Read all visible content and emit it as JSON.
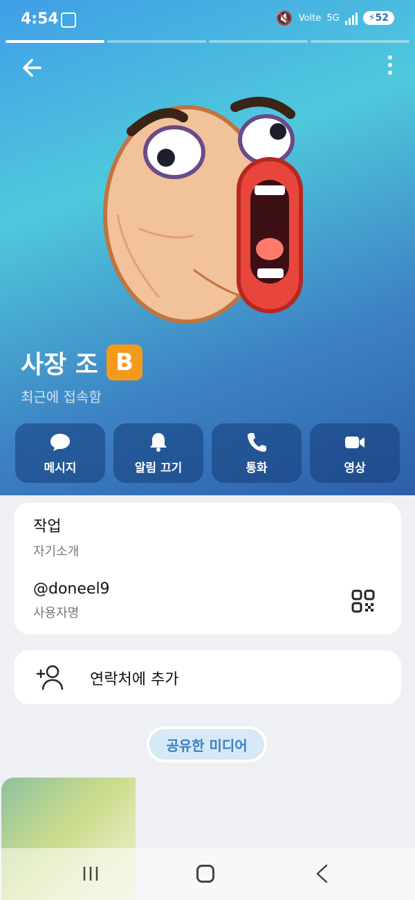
{
  "status_bar": {
    "time": "4:54",
    "network": "5G",
    "carrier_label": "Volte",
    "battery": "52"
  },
  "profile": {
    "name": "사장 조",
    "badge": "B",
    "status": "최근에 접속함"
  },
  "actions": [
    {
      "label": "메시지",
      "icon": "message-icon"
    },
    {
      "label": "알림 끄기",
      "icon": "bell-icon"
    },
    {
      "label": "통화",
      "icon": "phone-icon"
    },
    {
      "label": "영상",
      "icon": "video-icon"
    }
  ],
  "info": {
    "bio_value": "작업",
    "bio_label": "자기소개",
    "username_value": "@doneel9",
    "username_label": "사용자명"
  },
  "contact": {
    "add_label": "연락처에 추가"
  },
  "media": {
    "label": "공유한 미디어"
  },
  "colors": {
    "header_top": "#4fc9dc",
    "header_bottom": "#2c5fa8",
    "accent": "#3a80c3",
    "badge": "#f39a1c"
  }
}
